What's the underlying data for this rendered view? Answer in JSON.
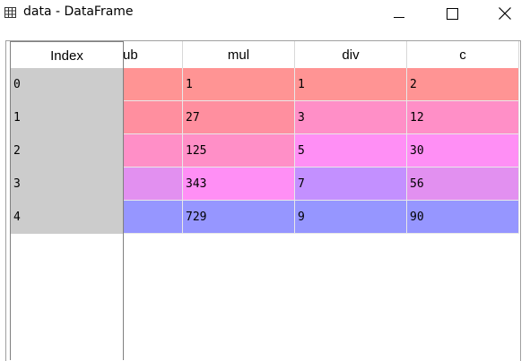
{
  "window": {
    "title": "data - DataFrame",
    "icon": "table-icon",
    "controls": [
      "minimize-icon",
      "maximize-icon",
      "close-icon"
    ]
  },
  "index": {
    "header": "Index",
    "rows": [
      "0",
      "1",
      "2",
      "3",
      "4"
    ]
  },
  "columns": {
    "headers": [
      "ub",
      "mul",
      "div",
      "c"
    ],
    "rows": [
      [
        "",
        "1",
        "1",
        "2"
      ],
      [
        "",
        "27",
        "3",
        "12"
      ],
      [
        "",
        "125",
        "5",
        "30"
      ],
      [
        "",
        "343",
        "7",
        "56"
      ],
      [
        "",
        "729",
        "9",
        "90"
      ]
    ]
  },
  "colors": {
    "sub": [
      "#ff9494",
      "#ff8f9f",
      "#ff8fc7",
      "#e290f0",
      "#9696ff"
    ],
    "mul": [
      "#ff9494",
      "#ff8f9f",
      "#ff8fc7",
      "#ff8ff5",
      "#9696ff"
    ],
    "div": [
      "#ff9494",
      "#ff8fc7",
      "#ff8ff5",
      "#c390ff",
      "#9696ff"
    ],
    "c": [
      "#ff9494",
      "#ff8fc7",
      "#ff8ff5",
      "#e290f0",
      "#9696ff"
    ],
    "index_bg": "#cccccc"
  }
}
